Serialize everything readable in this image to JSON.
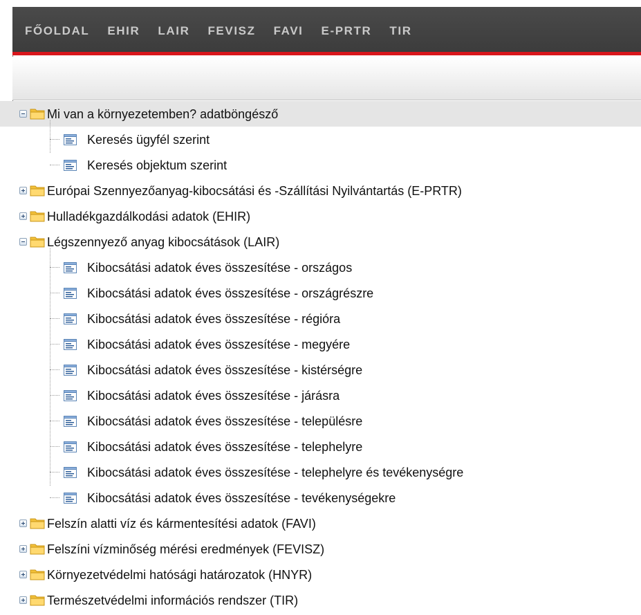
{
  "nav": {
    "items": [
      "FŐOLDAL",
      "EHIR",
      "LAIR",
      "FEVISZ",
      "FAVI",
      "E-PRTR",
      "TIR"
    ]
  },
  "icons": {
    "folder": "folder-icon",
    "document": "document-icon",
    "expand": "plus-icon",
    "collapse": "minus-icon"
  },
  "colors": {
    "nav_bg": "#404040",
    "nav_text": "#c9c9c9",
    "accent_red": "#d9161c",
    "selected_row": "#e5e5e5",
    "folder": "#ffd75e"
  },
  "tree": {
    "groups": [
      {
        "label": "Mi van a környezetemben? adatböngésző",
        "expanded": true,
        "selected": true,
        "children": [
          "Keresés ügyfél szerint",
          "Keresés objektum szerint"
        ]
      },
      {
        "label": "Európai Szennyezőanyag-kibocsátási és -Szállítási Nyilvántartás (E-PRTR)",
        "expanded": false,
        "children": []
      },
      {
        "label": "Hulladékgazdálkodási adatok (EHIR)",
        "expanded": false,
        "children": []
      },
      {
        "label": "Légszennyező anyag kibocsátások (LAIR)",
        "expanded": true,
        "children": [
          "Kibocsátási adatok éves összesítése - országos",
          "Kibocsátási adatok éves összesítése - országrészre",
          "Kibocsátási adatok éves összesítése - régióra",
          "Kibocsátási adatok éves összesítése - megyére",
          "Kibocsátási adatok éves összesítése - kistérségre",
          "Kibocsátási adatok éves összesítése - járásra",
          "Kibocsátási adatok éves összesítése - településre",
          "Kibocsátási adatok éves összesítése - telephelyre",
          "Kibocsátási adatok éves összesítése - telephelyre és tevékenységre",
          "Kibocsátási adatok éves összesítése - tevékenységekre"
        ]
      },
      {
        "label": "Felszín alatti víz és kármentesítési adatok (FAVI)",
        "expanded": false,
        "children": []
      },
      {
        "label": "Felszíni vízminőség mérési eredmények (FEVISZ)",
        "expanded": false,
        "children": []
      },
      {
        "label": "Környezetvédelmi hatósági határozatok (HNYR)",
        "expanded": false,
        "children": []
      },
      {
        "label": "Természetvédelmi információs rendszer (TIR)",
        "expanded": false,
        "children": []
      }
    ]
  }
}
